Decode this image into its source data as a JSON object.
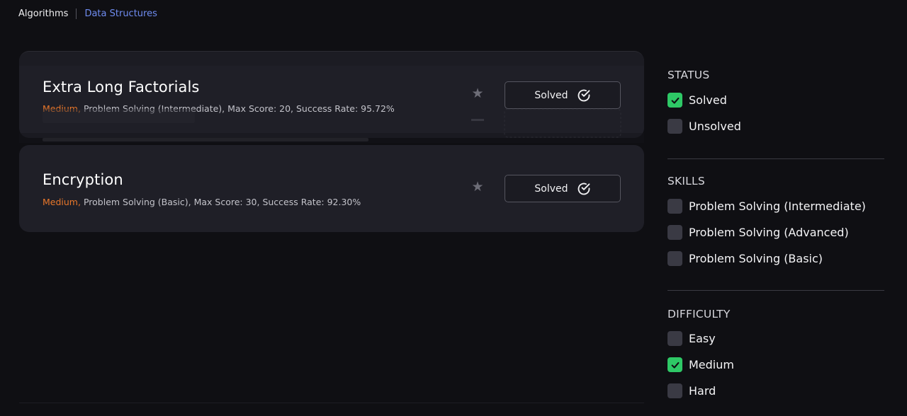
{
  "filters_top": {
    "algorithms_label": "Algorithms",
    "data_structures_label": "Data Structures"
  },
  "challenges": [
    {
      "title": "Extra Long Factorials",
      "difficulty": "Medium,",
      "meta": "Problem Solving (Intermediate), Max Score: 20, Success Rate: 95.72%",
      "status_label": "Solved",
      "star_icon": "star-icon"
    },
    {
      "title": "Encryption",
      "difficulty": "Medium,",
      "meta": "Problem Solving (Basic), Max Score: 30, Success Rate: 92.30%",
      "status_label": "Solved",
      "star_icon": "star-icon"
    }
  ],
  "sidebar": {
    "status": {
      "heading": "STATUS",
      "options": [
        {
          "label": "Solved",
          "checked": true
        },
        {
          "label": "Unsolved",
          "checked": false
        }
      ]
    },
    "skills": {
      "heading": "SKILLS",
      "options": [
        {
          "label": "Problem Solving (Intermediate)",
          "checked": false
        },
        {
          "label": "Problem Solving (Advanced)",
          "checked": false
        },
        {
          "label": "Problem Solving (Basic)",
          "checked": false
        }
      ]
    },
    "difficulty": {
      "heading": "DIFFICULTY",
      "options": [
        {
          "label": "Easy",
          "checked": false
        },
        {
          "label": "Medium",
          "checked": true
        },
        {
          "label": "Hard",
          "checked": false
        }
      ]
    }
  },
  "colors": {
    "background": "#0f0f13",
    "card": "#1f1f27",
    "accent_green": "#2ec866",
    "difficulty_orange": "#e9772a",
    "link_blue": "#6f8cf0"
  }
}
